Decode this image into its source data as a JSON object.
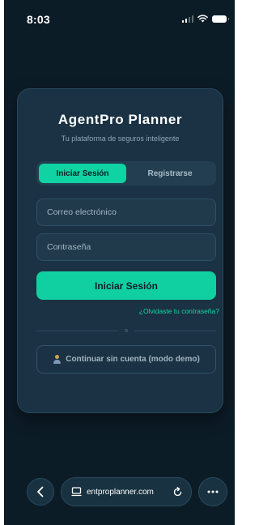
{
  "status_bar": {
    "time": "8:03"
  },
  "card": {
    "brand": "AgentPro Planner",
    "tagline": "Tu plataforma de seguros inteligente",
    "tabs": [
      {
        "label": "Iniciar Sesión",
        "active": true
      },
      {
        "label": "Registrarse",
        "active": false
      }
    ],
    "email": {
      "placeholder": "Correo electrónico",
      "value": ""
    },
    "password": {
      "placeholder": "Contraseña",
      "value": ""
    },
    "submit_label": "Iniciar Sesión",
    "forgot_label": "¿Olvidaste tu contraseña?",
    "divider_label": "o",
    "demo_label": "Continuar sin cuenta (modo demo)"
  },
  "browser": {
    "url": "entproplanner.com",
    "icons": [
      "chevron-left-icon",
      "tab-icon",
      "reload-icon",
      "more-icon"
    ]
  },
  "colors": {
    "background": "#0c1c27",
    "card": "#1a3243",
    "accent": "#10d0a1"
  }
}
